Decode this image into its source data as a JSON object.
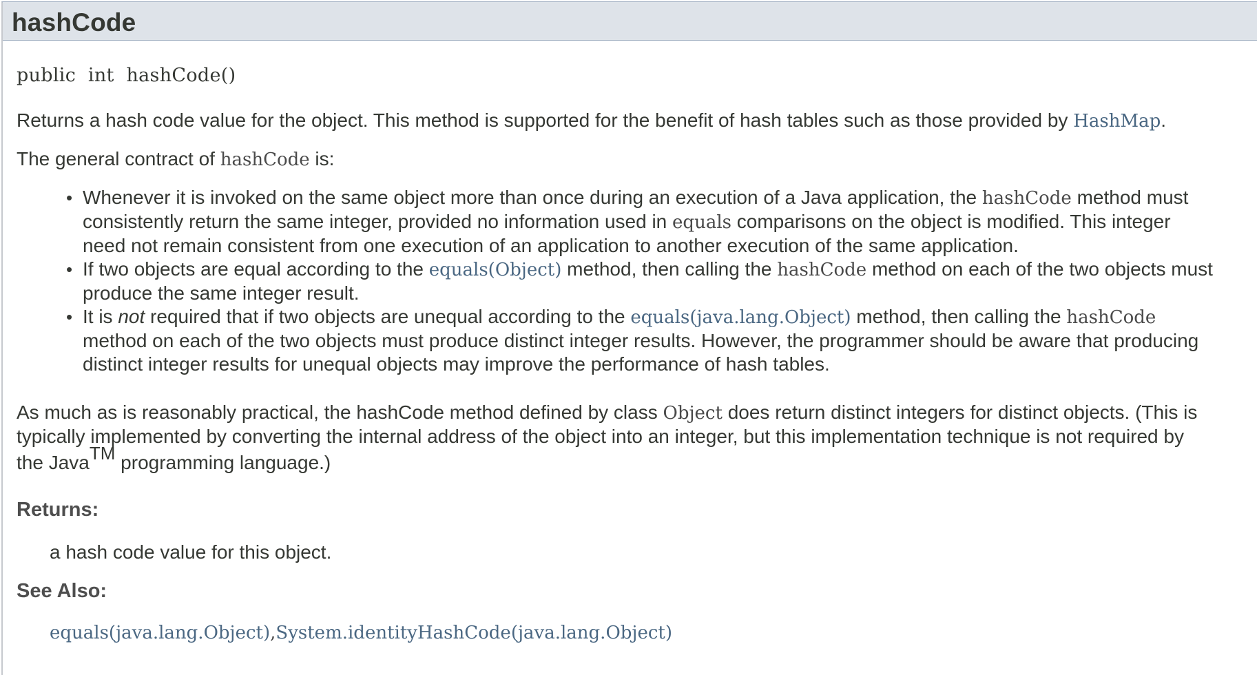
{
  "header": {
    "title": "hashCode"
  },
  "signature": {
    "modifier": "public",
    "type": "int",
    "name": "hashCode()"
  },
  "description": {
    "p1_text": "Returns a hash code value for the object. This method is supported for the benefit of hash tables such as those provided by ",
    "p1_link": "HashMap",
    "p1_end": ".",
    "p2_start": "The general contract of ",
    "p2_code": "hashCode",
    "p2_end": " is:"
  },
  "contract": {
    "b1_l1_a": "Whenever it is invoked on the same object more than once during an execution of a Java application, the ",
    "b1_l1_code": "hashCode",
    "b1_l1_b": " method must",
    "b1_l2_a": "consistently return the same integer, provided no information used in ",
    "b1_l2_code": "equals",
    "b1_l2_b": " comparisons on the object is modified. This integer",
    "b1_l3": "need not remain consistent from one execution of an application to another execution of the same application.",
    "b2_l1_a": "If two objects are equal according to the ",
    "b2_l1_link": "equals(Object)",
    "b2_l1_b": " method, then calling the ",
    "b2_l1_code": "hashCode",
    "b2_l1_c": " method on each of the two objects must",
    "b2_l2": "produce the same integer result.",
    "b3_l1_a": "It is ",
    "b3_l1_em": "not",
    "b3_l1_b": " required that if two objects are unequal according to the ",
    "b3_l1_link": "equals(java.lang.Object)",
    "b3_l1_c": " method, then calling the ",
    "b3_l1_code": "hashCode",
    "b3_l2": "method on each of the two objects must produce distinct integer results. However, the programmer should be aware that producing",
    "b3_l3": "distinct integer results for unequal objects may improve the performance of hash tables."
  },
  "practical": {
    "l1_a": "As much as is reasonably practical, the hashCode method defined by class ",
    "l1_code": "Object",
    "l1_b": " does return distinct integers for distinct objects. (This is",
    "l2": "typically implemented by converting the internal address of the object into an integer, but this implementation technique is not required by",
    "l3_a": "the Java",
    "l3_sup": "TM",
    "l3_b": " programming language.)"
  },
  "returns": {
    "label": "Returns:",
    "value": "a hash code value for this object."
  },
  "see_also": {
    "label": "See Also:",
    "link1": "equals(java.lang.Object)",
    "separator": ",",
    "link2": "System.identityHashCode(java.lang.Object)"
  }
}
